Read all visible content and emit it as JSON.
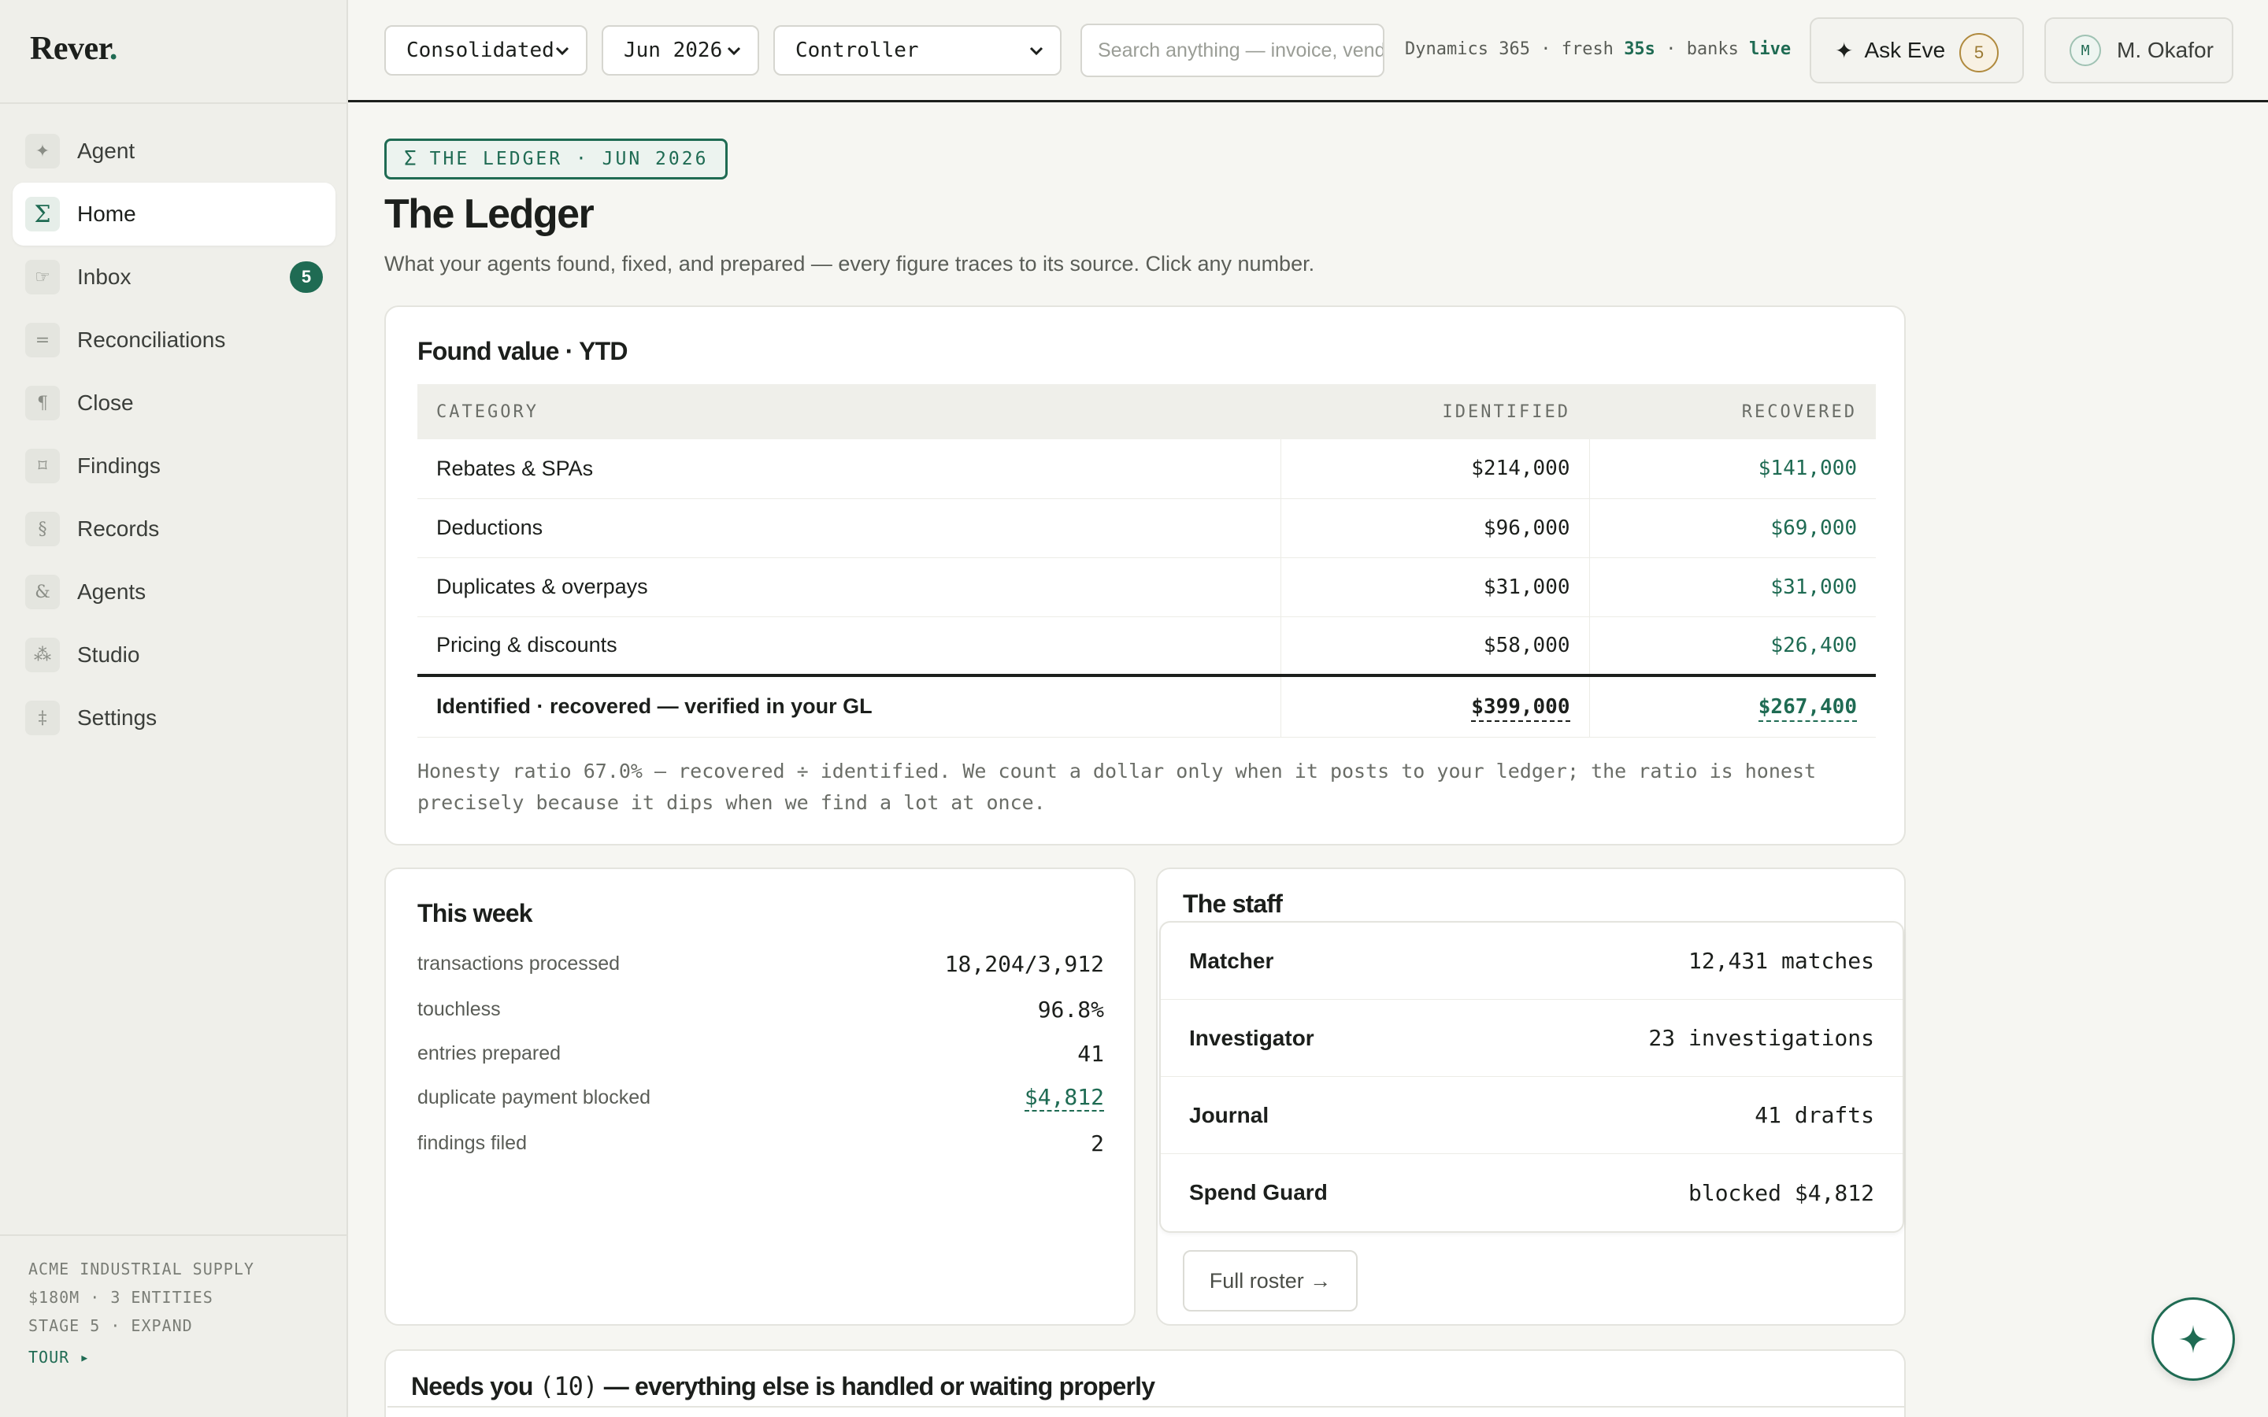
{
  "app": {
    "logo": "Rever",
    "logo_dot": "."
  },
  "sidebar": {
    "items": [
      {
        "label": "Agent",
        "icon": "✦",
        "icon_name": "sparkle-icon"
      },
      {
        "label": "Home",
        "icon": "Σ",
        "icon_name": "sigma-icon"
      },
      {
        "label": "Inbox",
        "icon": "☞",
        "icon_name": "pointing-hand-icon",
        "badge": "5"
      },
      {
        "label": "Reconciliations",
        "icon": "=",
        "icon_name": "equals-icon"
      },
      {
        "label": "Close",
        "icon": "¶",
        "icon_name": "pilcrow-icon"
      },
      {
        "label": "Findings",
        "icon": "⌑",
        "icon_name": "findings-icon"
      },
      {
        "label": "Records",
        "icon": "§",
        "icon_name": "section-icon"
      },
      {
        "label": "Agents",
        "icon": "&",
        "icon_name": "ampersand-icon"
      },
      {
        "label": "Studio",
        "icon": "⁂",
        "icon_name": "asterism-icon"
      },
      {
        "label": "Settings",
        "icon": "‡",
        "icon_name": "double-dagger-icon"
      }
    ],
    "active": "Home",
    "footer": {
      "company": "ACME INDUSTRIAL SUPPLY",
      "meta": "$180M · 3 ENTITIES",
      "stage": "STAGE 5 · EXPAND",
      "tour": "TOUR ▸"
    }
  },
  "topbar": {
    "entity_select": "Consolidated",
    "period_select": "Jun 2026",
    "role_select": "Controller",
    "search_placeholder": "Search anything — invoice, vendor, amount",
    "status": {
      "source": "Dynamics 365",
      "fresh_label": "fresh",
      "fresh_value": "35s",
      "banks_label": "banks",
      "banks_value": "live",
      "sep": "·"
    },
    "ask": {
      "label": "Ask Eve",
      "count": "5"
    },
    "user": {
      "initial": "M",
      "name": "M. Okafor"
    }
  },
  "page": {
    "eyebrow": "THE LEDGER · JUN 2026",
    "eyebrow_icon": "Σ",
    "title": "The Ledger",
    "subtitle": "What your agents found, fixed, and prepared — every figure traces to its source. Click any number."
  },
  "found_value": {
    "title": "Found value · YTD",
    "columns": [
      "CATEGORY",
      "IDENTIFIED",
      "RECOVERED"
    ],
    "rows": [
      {
        "category": "Rebates & SPAs",
        "identified": "$214,000",
        "recovered": "$141,000"
      },
      {
        "category": "Deductions",
        "identified": "$96,000",
        "recovered": "$69,000"
      },
      {
        "category": "Duplicates & overpays",
        "identified": "$31,000",
        "recovered": "$31,000"
      },
      {
        "category": "Pricing & discounts",
        "identified": "$58,000",
        "recovered": "$26,400"
      }
    ],
    "total": {
      "label": "Identified · recovered — verified in your GL",
      "identified": "$399,000",
      "recovered": "$267,400"
    },
    "note": "Honesty ratio 67.0% — recovered ÷ identified. We count a dollar only when it posts to your ledger; the ratio is honest precisely because it dips when we find a lot at once."
  },
  "this_week": {
    "title": "This week",
    "rows": [
      {
        "label": "transactions processed",
        "value": "18,204/3,912"
      },
      {
        "label": "touchless",
        "value": "96.8%"
      },
      {
        "label": "entries prepared",
        "value": "41"
      },
      {
        "label": "duplicate payment blocked",
        "value": "$4,812"
      },
      {
        "label": "findings filed",
        "value": "2"
      }
    ]
  },
  "staff": {
    "title": "The staff",
    "rows": [
      {
        "name": "Matcher",
        "metric": "12,431 matches"
      },
      {
        "name": "Investigator",
        "metric": "23 investigations"
      },
      {
        "name": "Journal",
        "metric": "41 drafts"
      },
      {
        "name": "Spend Guard",
        "metric": "blocked $4,812"
      }
    ],
    "roster_button": "Full roster →"
  },
  "needs_you": {
    "title_pre": "Needs you",
    "count": "(10)",
    "title_post": "— everything else is handled or waiting properly"
  },
  "colors": {
    "accent": "#1f6b53",
    "background": "#f6f6f2",
    "badge_gold": "#b08a3e"
  }
}
